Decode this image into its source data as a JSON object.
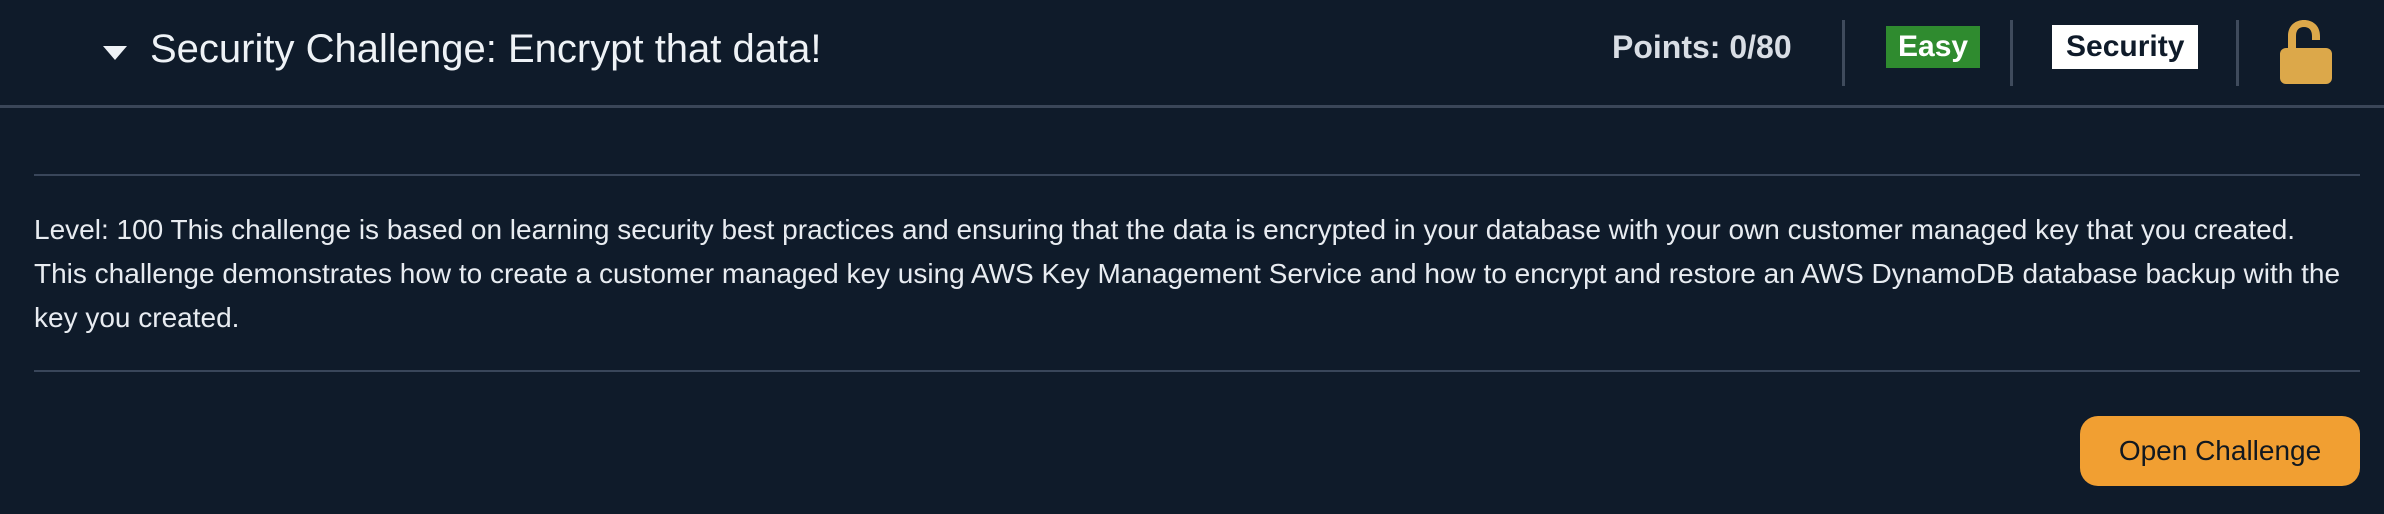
{
  "challenge": {
    "title": "Security Challenge: Encrypt that data!",
    "points": "Points: 0/80",
    "difficulty": "Easy",
    "category": "Security",
    "lock_state": "unlocked",
    "description": "Level: 100 This challenge is based on learning security best practices and ensuring that the data is encrypted in your database with your own customer managed key that you created.  This challenge demonstrates how to create a customer managed key using AWS Key Management Service and how to encrypt and restore an AWS DynamoDB database backup with the key you created.",
    "open_label": "Open Challenge"
  },
  "icons": {
    "caret": "caret-down-icon",
    "lock": "unlocked-padlock-icon"
  },
  "colors": {
    "background": "#0f1b2a",
    "easy_badge": "#2f8b2f",
    "category_badge": "#ffffff",
    "lock": "#dca84a",
    "button": "#f19f32"
  }
}
